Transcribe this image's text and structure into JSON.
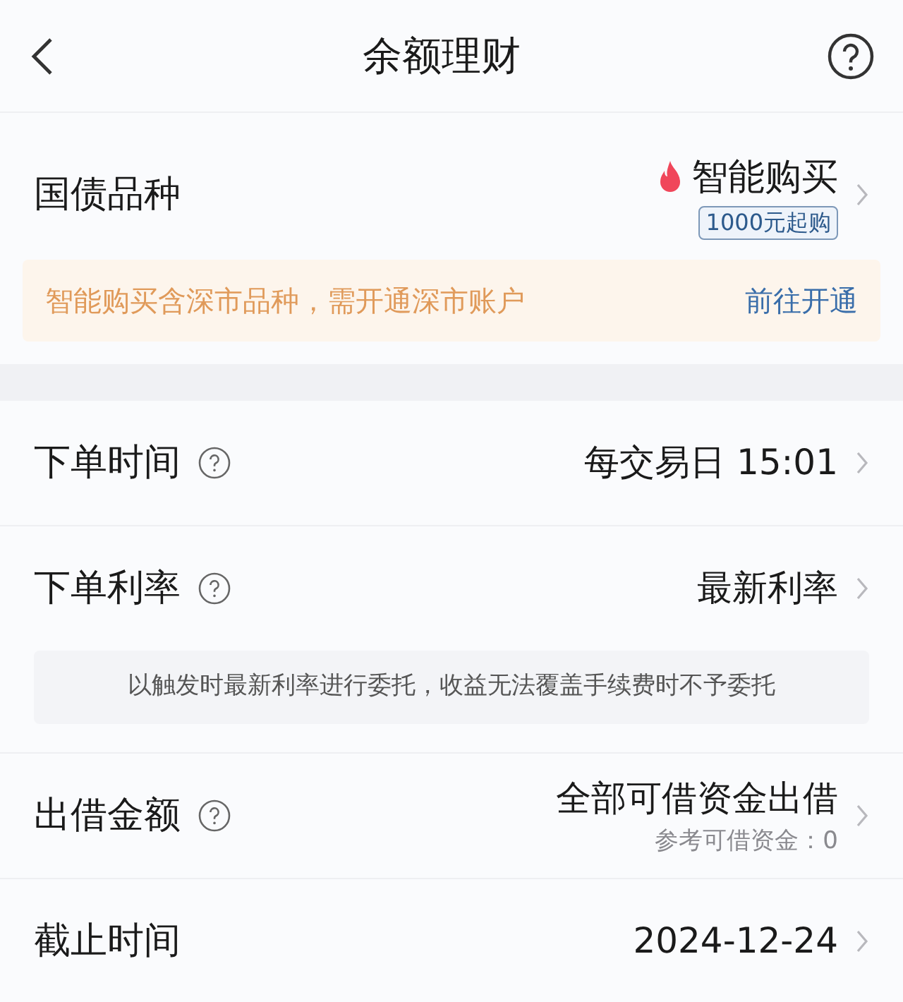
{
  "header": {
    "title": "余额理财"
  },
  "product": {
    "label": "国债品种",
    "value": "智能购买",
    "badge": "1000元起购",
    "notice": {
      "text": "智能购买含深市品种，需开通深市账户",
      "link": "前往开通"
    }
  },
  "settings": [
    {
      "label": "下单时间",
      "help": true,
      "value": "每交易日 15:01"
    },
    {
      "label": "下单利率",
      "help": true,
      "value": "最新利率",
      "note": "以触发时最新利率进行委托，收益无法覆盖手续费时不予委托"
    },
    {
      "label": "出借金额",
      "help": true,
      "value": "全部可借资金出借",
      "subtext": "参考可借资金：0"
    },
    {
      "label": "截止时间",
      "help": false,
      "value": "2024-12-24"
    }
  ]
}
